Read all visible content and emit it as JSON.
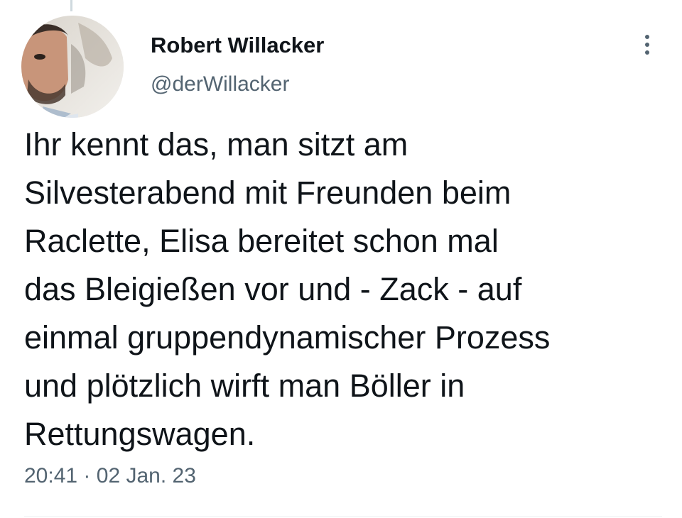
{
  "tweet": {
    "author": {
      "name": "Robert Willacker",
      "handle": "@derWillacker",
      "avatar_icon": "profile-photo"
    },
    "text_lines": [
      "Ihr kennt das, man sitzt am",
      "Silvesterabend mit Freunden beim",
      "Raclette, Elisa bereitet schon mal",
      "das Bleigießen vor und - Zack - auf",
      "einmal gruppendynamischer Prozess",
      "und plötzlich wirft man Böller in",
      "Rettungswagen."
    ],
    "time": "20:41",
    "separator": "·",
    "date": "02 Jan. 23",
    "more_icon": "more-vertical-icon"
  },
  "colors": {
    "text_primary": "#0f1419",
    "text_secondary": "#536471",
    "divider": "#eff3f4"
  }
}
